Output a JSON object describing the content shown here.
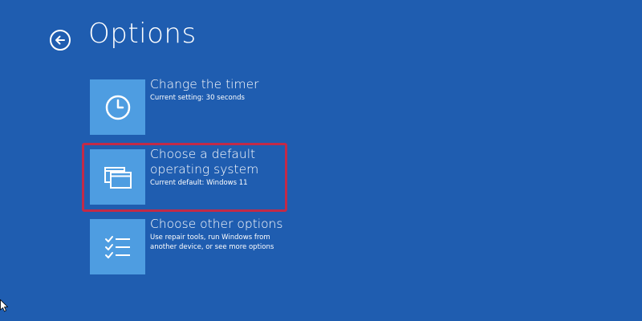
{
  "page": {
    "title": "Options",
    "back_icon": "back-arrow-icon"
  },
  "options": [
    {
      "title": "Change the timer",
      "description": "Current setting: 30 seconds",
      "icon": "clock-icon"
    },
    {
      "title": "Choose a default operating system",
      "description": "Current default: Windows 11",
      "icon": "windows-stack-icon",
      "highlighted": true
    },
    {
      "title": "Choose other options",
      "description": "Use repair tools, run Windows from another device, or see more options",
      "icon": "checklist-icon"
    }
  ],
  "colors": {
    "background": "#1f5db0",
    "tile": "#4e9de1",
    "highlight": "#c22a48"
  }
}
